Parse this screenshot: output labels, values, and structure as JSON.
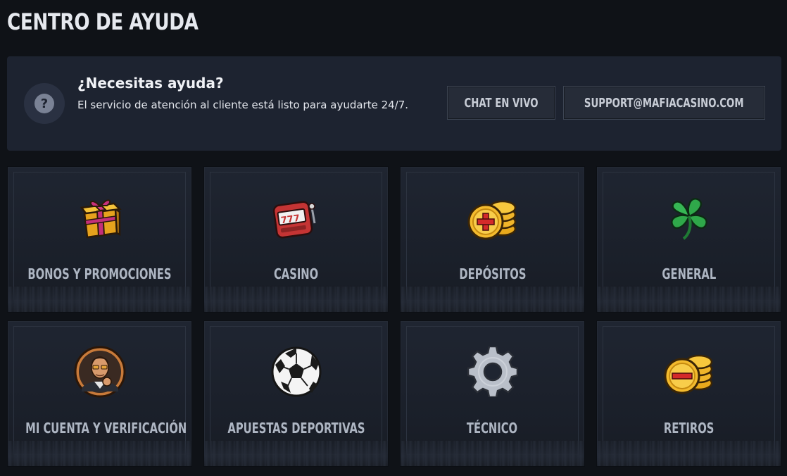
{
  "header": {
    "title": "CENTRO DE AYUDA"
  },
  "help_banner": {
    "icon": "question-icon",
    "icon_glyph": "?",
    "heading": "¿Necesitas ayuda?",
    "text": "El servicio de atención al cliente está listo para ayudarte 24/7.",
    "chat_button": "CHAT EN VIVO",
    "email_button": "SUPPORT@MAFIACASINO.COM"
  },
  "categories": [
    {
      "label": "BONOS Y PROMOCIONES",
      "icon": "gift-icon"
    },
    {
      "label": "CASINO",
      "icon": "slot-machine-icon"
    },
    {
      "label": "DEPÓSITOS",
      "icon": "coins-plus-icon"
    },
    {
      "label": "GENERAL",
      "icon": "clover-icon"
    },
    {
      "label": "MI CUENTA Y VERIFICACIÓN",
      "icon": "avatar-mobster-icon"
    },
    {
      "label": "APUESTAS DEPORTIVAS",
      "icon": "soccer-ball-icon"
    },
    {
      "label": "TÉCNICO",
      "icon": "gear-icon"
    },
    {
      "label": "RETIROS",
      "icon": "coins-minus-icon"
    }
  ],
  "colors": {
    "background": "#0f1217",
    "banner": "#1d2330",
    "card": "#1f2531",
    "label": "#aeb6c3",
    "gold": "#f2b320",
    "red": "#d42a2a",
    "green": "#2fa84a"
  }
}
